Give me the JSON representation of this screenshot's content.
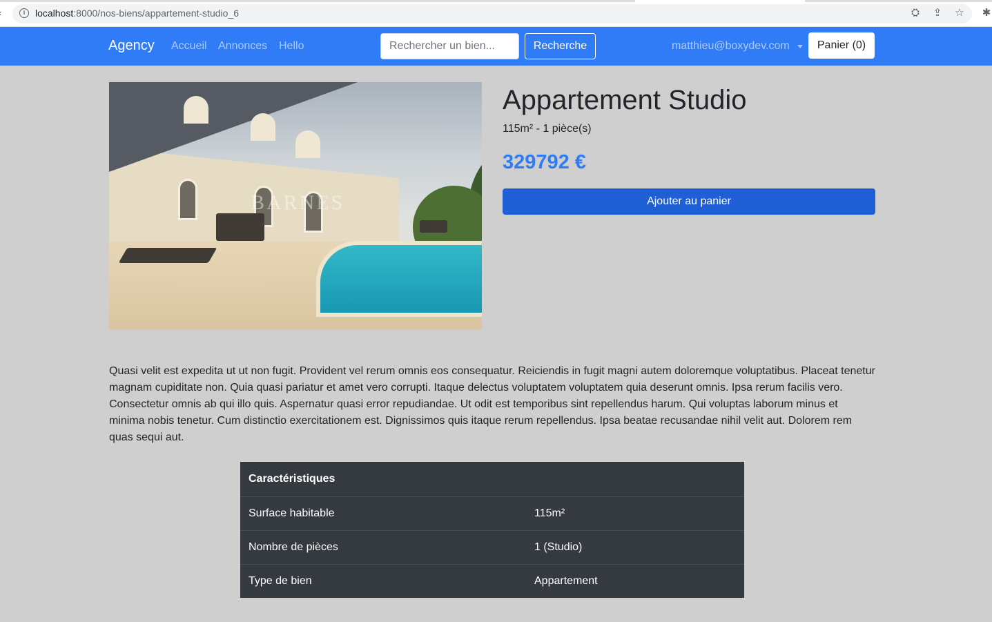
{
  "browser": {
    "url_host": "localhost",
    "url_rest": ":8000/nos-biens/appartement-studio_6"
  },
  "navbar": {
    "brand": "Agency",
    "links": [
      "Accueil",
      "Annonces",
      "Hello"
    ],
    "search_placeholder": "Rechercher un bien...",
    "search_button": "Recherche",
    "user_email": "matthieu@boxydev.com",
    "cart_button": "Panier (0)"
  },
  "property": {
    "image_watermark": "BARNES",
    "title": "Appartement Studio",
    "subtitle": "115m² - 1 pièce(s)",
    "price": "329792 €",
    "add_to_cart": "Ajouter au panier",
    "description": "Quasi velit est expedita ut ut non fugit. Provident vel rerum omnis eos consequatur. Reiciendis in fugit magni autem doloremque voluptatibus. Placeat tenetur magnam cupiditate non. Quia quasi pariatur et amet vero corrupti. Itaque delectus voluptatem voluptatem quia deserunt omnis. Ipsa rerum facilis vero. Consectetur omnis ab qui illo quis. Aspernatur quasi error repudiandae. Ut odit est temporibus sint repellendus harum. Qui voluptas laborum minus et minima nobis tenetur. Cum distinctio exercitationem est. Dignissimos quis itaque rerum repellendus. Ipsa beatae recusandae nihil velit aut. Dolorem rem quas sequi aut."
  },
  "characteristics": {
    "header": "Caractéristiques",
    "rows": [
      {
        "label": "Surface habitable",
        "value": "115m²"
      },
      {
        "label": "Nombre de pièces",
        "value": "1 (Studio)"
      },
      {
        "label": "Type de bien",
        "value": "Appartement"
      }
    ]
  },
  "colors": {
    "navbar": "#2f7cf6",
    "price": "#2f7cf6",
    "primary_button": "#1f5fd6",
    "page_background": "#cfcfcf",
    "table_background": "#343a40"
  },
  "icons": [
    "info-icon",
    "translate-icon",
    "share-icon",
    "star-icon",
    "extensions-icon",
    "chevron-down-icon"
  ]
}
